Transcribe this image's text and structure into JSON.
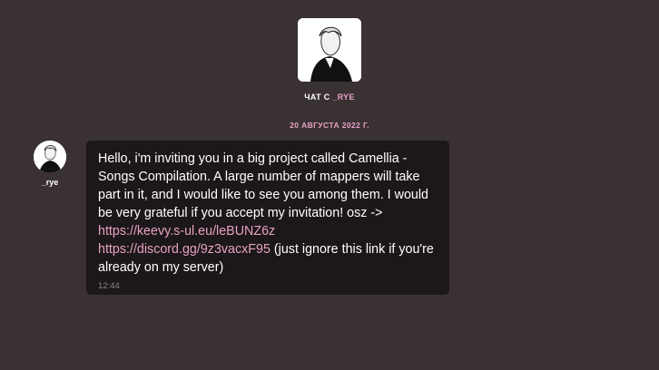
{
  "header": {
    "title_prefix": "ЧАТ С",
    "username": "_RYE",
    "avatar_icon": "anime-character-avatar-icon"
  },
  "date_divider": "20 АВГУСТА 2022 Г.",
  "message": {
    "sender": "_rye",
    "avatar_icon": "anime-character-avatar-icon",
    "text_part1": "Hello, i'm inviting you in a big project called Camellia - Songs Compilation. A large number of mappers will take part in it, and I would like to see you among them. I would be very grateful if you accept my invitation! osz -> ",
    "link1": "https://keevy.s-ul.eu/leBUNZ6z",
    "link2": "https://discord.gg/9z3vacxF95",
    "text_part2": " (just ignore this link if you're already on my server)",
    "time": "12:44"
  },
  "colors": {
    "background": "#3a3133",
    "bubble": "#1c1719",
    "accent": "#e7a2c4",
    "time": "#8e8689"
  }
}
